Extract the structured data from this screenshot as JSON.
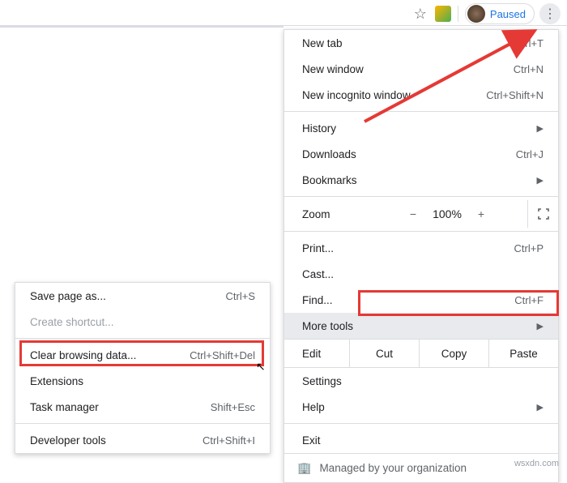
{
  "toolbar": {
    "paused": "Paused"
  },
  "menu": {
    "new_tab": {
      "label": "New tab",
      "sc": "Ctrl+T"
    },
    "new_window": {
      "label": "New window",
      "sc": "Ctrl+N"
    },
    "new_incognito": {
      "label": "New incognito window",
      "sc": "Ctrl+Shift+N"
    },
    "history": {
      "label": "History"
    },
    "downloads": {
      "label": "Downloads",
      "sc": "Ctrl+J"
    },
    "bookmarks": {
      "label": "Bookmarks"
    },
    "zoom": {
      "label": "Zoom",
      "minus": "−",
      "value": "100%",
      "plus": "+"
    },
    "print": {
      "label": "Print...",
      "sc": "Ctrl+P"
    },
    "cast": {
      "label": "Cast..."
    },
    "find": {
      "label": "Find...",
      "sc": "Ctrl+F"
    },
    "more_tools": {
      "label": "More tools"
    },
    "edit": {
      "label": "Edit",
      "cut": "Cut",
      "copy": "Copy",
      "paste": "Paste"
    },
    "settings": {
      "label": "Settings"
    },
    "help": {
      "label": "Help"
    },
    "exit": {
      "label": "Exit"
    },
    "managed": {
      "label": "Managed by your organization"
    }
  },
  "submenu": {
    "save_page": {
      "label": "Save page as...",
      "sc": "Ctrl+S"
    },
    "create_shortcut": {
      "label": "Create shortcut..."
    },
    "clear_data": {
      "label": "Clear browsing data...",
      "sc": "Ctrl+Shift+Del"
    },
    "extensions": {
      "label": "Extensions"
    },
    "task_manager": {
      "label": "Task manager",
      "sc": "Shift+Esc"
    },
    "dev_tools": {
      "label": "Developer tools",
      "sc": "Ctrl+Shift+I"
    }
  },
  "watermark": "wsxdn.com"
}
